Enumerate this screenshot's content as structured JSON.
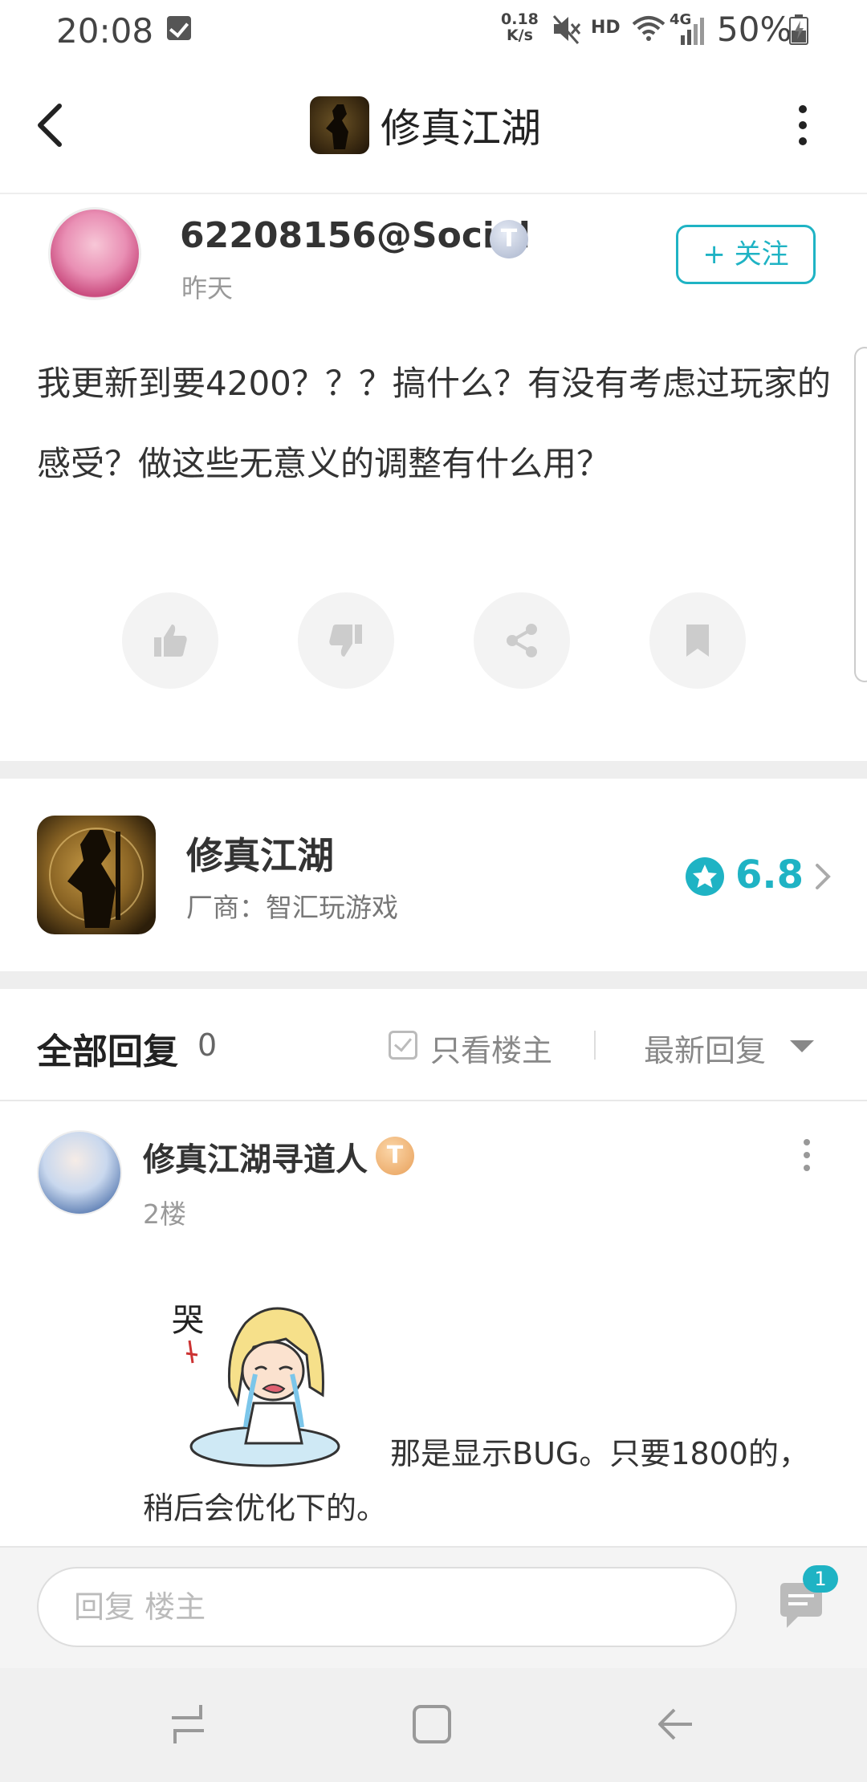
{
  "status_bar": {
    "time": "20:08",
    "net_speed_value": "0.18",
    "net_speed_unit": "K/s",
    "hd": "HD",
    "network": "4G",
    "battery": "50%"
  },
  "header": {
    "title": "修真江湖"
  },
  "post": {
    "username": "62208156@Social",
    "level_badge": "T",
    "time": "昨天",
    "follow_label": "+ 关注",
    "content": "我更新到要4200？？？搞什么？有没有考虑过玩家的感受？做这些无意义的调整有什么用？"
  },
  "game_card": {
    "name": "修真江湖",
    "vendor": "厂商：智汇玩游戏",
    "rating": "6.8"
  },
  "replies": {
    "title": "全部回复",
    "count": "0",
    "only_owner": "只看楼主",
    "sort": "最新回复",
    "items": [
      {
        "user": "修真江湖寻道人",
        "badge": "T",
        "floor": "2楼",
        "text_line1": "那是显示BUG。只要1800的，",
        "text_line2": "稍后会优化下的。"
      }
    ]
  },
  "input": {
    "placeholder": "回复  楼主",
    "comment_count": "1"
  },
  "colors": {
    "accent": "#1fb3c4",
    "badge_silver": "#a9b4cc",
    "badge_gold": "#e8a05a"
  }
}
